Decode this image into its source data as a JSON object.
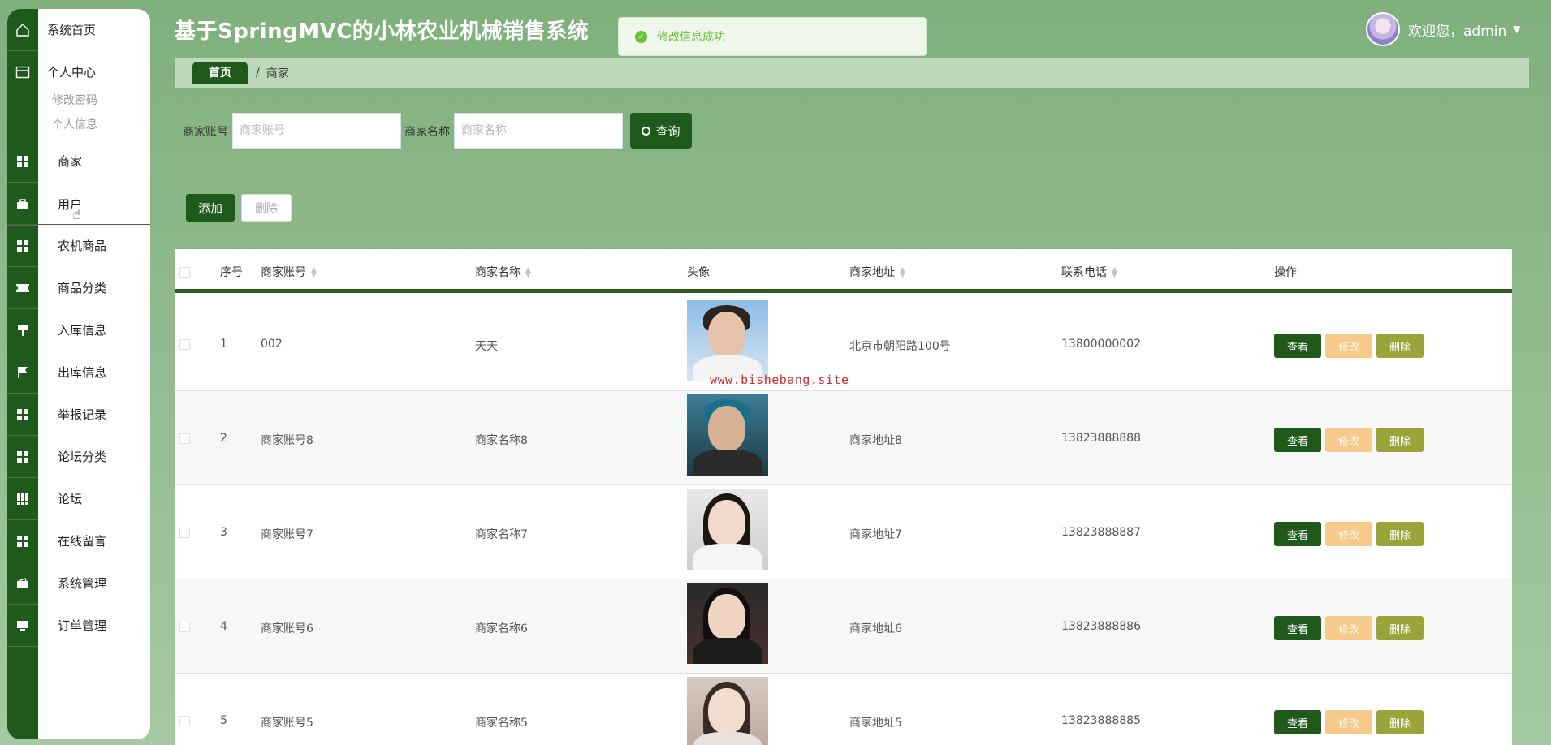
{
  "header": {
    "title": "基于SpringMVC的小林农业机械销售系统",
    "toast": "修改信息成功",
    "welcome": "欢迎您，admin"
  },
  "sidebar": {
    "home": "系统首页",
    "personal": "个人中心",
    "personal_sub": [
      "修改密码",
      "个人信息"
    ],
    "items": [
      "商家",
      "用户",
      "农机商品",
      "商品分类",
      "入库信息",
      "出库信息",
      "举报记录",
      "论坛分类",
      "论坛",
      "在线留言",
      "系统管理",
      "订单管理"
    ]
  },
  "breadcrumb": {
    "home": "首页",
    "sep": "/",
    "current": "商家"
  },
  "search": {
    "account_label": "商家账号",
    "account_placeholder": "商家账号",
    "name_label": "商家名称",
    "name_placeholder": "商家名称",
    "button": "查询"
  },
  "toolbar": {
    "add": "添加",
    "delete": "删除"
  },
  "table": {
    "headers": [
      "序号",
      "商家账号",
      "商家名称",
      "头像",
      "商家地址",
      "联系电话",
      "操作"
    ],
    "rows": [
      {
        "no": "1",
        "account": "002",
        "name": "天天",
        "address": "北京市朝阳路100号",
        "phone": "13800000002"
      },
      {
        "no": "2",
        "account": "商家账号8",
        "name": "商家名称8",
        "address": "商家地址8",
        "phone": "13823888888"
      },
      {
        "no": "3",
        "account": "商家账号7",
        "name": "商家名称7",
        "address": "商家地址7",
        "phone": "13823888887"
      },
      {
        "no": "4",
        "account": "商家账号6",
        "name": "商家名称6",
        "address": "商家地址6",
        "phone": "13823888886"
      },
      {
        "no": "5",
        "account": "商家账号5",
        "name": "商家名称5",
        "address": "商家地址5",
        "phone": "13823888885"
      }
    ],
    "actions": {
      "view": "查看",
      "edit": "修改",
      "delete": "删除"
    }
  },
  "watermark": "www.bishebang.site",
  "colors": {
    "primary": "#1f5a1c",
    "edit": "#f6c98d",
    "delete": "#9aa43a",
    "toast": "#67c23a"
  }
}
